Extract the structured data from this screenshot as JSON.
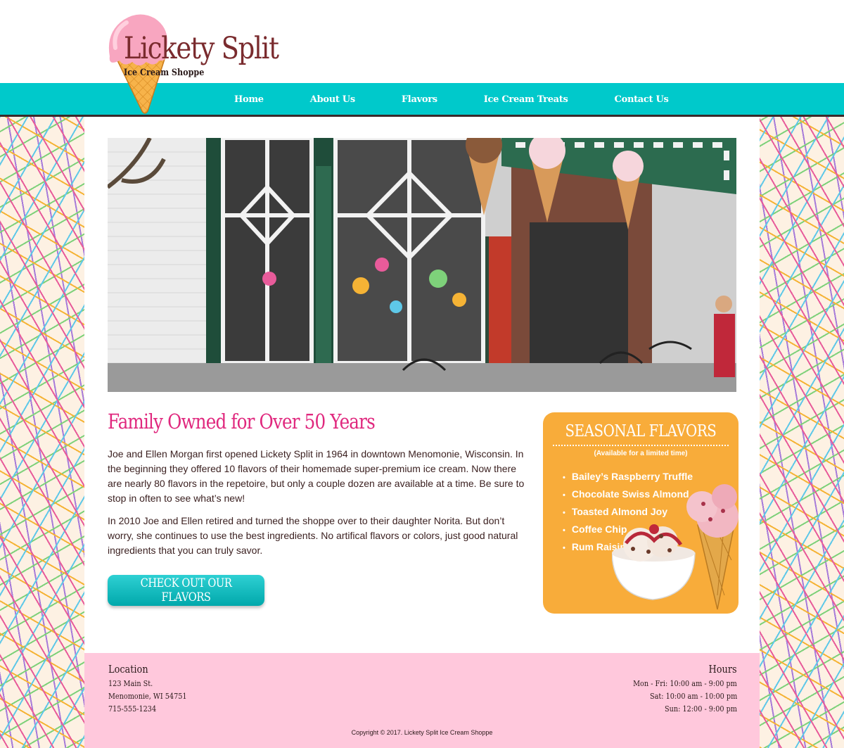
{
  "logo": {
    "title": "Lickety Split",
    "subtitle": "Ice Cream Shoppe"
  },
  "nav": [
    {
      "label": "Home"
    },
    {
      "label": "About Us"
    },
    {
      "label": "Flavors"
    },
    {
      "label": "Ice Cream Treats"
    },
    {
      "label": "Contact Us"
    }
  ],
  "intro": {
    "heading": "Family Owned for Over 50 Years",
    "paragraph1": "Joe and Ellen Morgan first opened Lickety Split in 1964 in downtown Menomonie, Wisconsin. In the beginning they offered 10 flavors of their homemade super-premium ice cream. Now there are nearly 80 flavors in the repetoire, but only a couple dozen are available at a time. Be sure to stop in often to see what’s new!",
    "paragraph2": "In 2010 Joe and Ellen retired and turned the shoppe over to their daughter Norita. But don’t worry, she continues to use the best ingredients. No artifical flavors or colors, just good natural ingredients that you can truly savor.",
    "cta_label": "Check Out Our Flavors"
  },
  "seasonal": {
    "title": "Seasonal Flavors",
    "note": "(Available for a limited time)",
    "items": [
      "Bailey’s Raspberry Truffle",
      "Chocolate Swiss Almond",
      "Toasted Almond Joy",
      "Coffee Chip",
      "Rum Raisin"
    ]
  },
  "footer": {
    "location_label": "Location",
    "address1": "123 Main St.",
    "address2": "Menomonie, WI 54751",
    "phone": "715-555-1234",
    "hours_label": "Hours",
    "hours1": "Mon - Fri: 10:00 am - 9:00 pm",
    "hours2": "Sat: 10:00 am - 10:00 pm",
    "hours3": "Sun: 12:00 - 9:00 pm",
    "copyright": "Copyright © 2017. Lickety Split Ice Cream Shoppe"
  },
  "colors": {
    "nav": "#00c9cb",
    "heading_pink": "#e0287e",
    "logo_brown": "#7a2b2e",
    "seasonal_orange": "#f8ac3a",
    "footer_pink": "#ffc8dc"
  }
}
